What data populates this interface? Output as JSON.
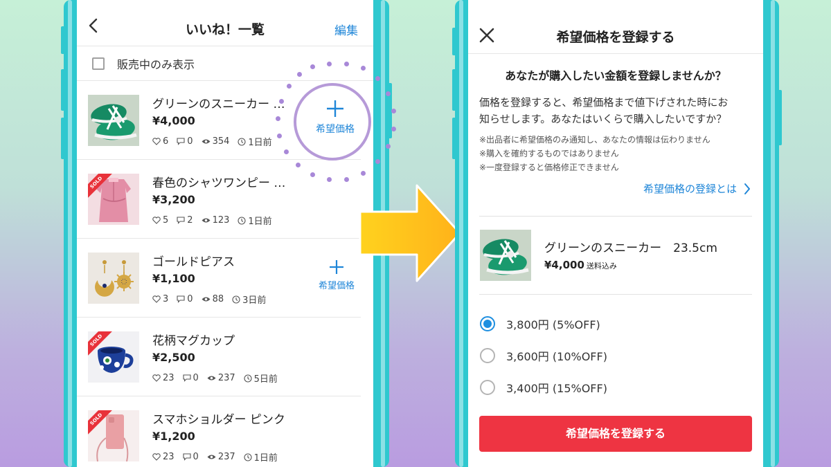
{
  "colors": {
    "accent_blue": "#1f86d8",
    "submit_red": "#ee3442",
    "phone_frame": "#2fc8cf",
    "ring_purple": "#b69ad8",
    "arrow_yellow": "#ffc21a"
  },
  "left": {
    "header": {
      "title": "いいね！一覧",
      "edit_label": "編集"
    },
    "filter": {
      "label": "販売中のみ表示",
      "checked": false
    },
    "items": [
      {
        "name": "グリーンのスニーカー …",
        "price": "¥4,000",
        "likes": "6",
        "comments": "0",
        "views": "354",
        "time": "1日前",
        "sold": false,
        "image": "green-sneakers"
      },
      {
        "name": "春色のシャツワンピー …",
        "price": "¥3,200",
        "likes": "5",
        "comments": "2",
        "views": "123",
        "time": "1日前",
        "sold": true,
        "image": "pink-dress"
      },
      {
        "name": "ゴールドピアス",
        "price": "¥1,100",
        "likes": "3",
        "comments": "0",
        "views": "88",
        "time": "3日前",
        "sold": false,
        "image": "gold-earrings"
      },
      {
        "name": "花柄マグカップ",
        "price": "¥2,500",
        "likes": "23",
        "comments": "0",
        "views": "237",
        "time": "5日前",
        "sold": true,
        "image": "floral-mug"
      },
      {
        "name": "スマホショルダー ピンク",
        "price": "¥1,200",
        "likes": "23",
        "comments": "0",
        "views": "237",
        "time": "1日前",
        "sold": true,
        "image": "pink-phone-case"
      }
    ],
    "sold_label": "SOLD",
    "wish_button_label": "希望価格"
  },
  "right": {
    "header": {
      "title": "希望価格を登録する"
    },
    "lead": "あなたが購入したい金額を登録しませんか？",
    "desc_line1": "価格を登録すると、希望価格まで値下げされた時にお",
    "desc_line2": "知らせします。あなたはいくらで購入したいですか？",
    "notes": [
      "※出品者に希望価格のみ通知し、あなたの情報は伝わりません",
      "※購入を確約するものではありません",
      "※一度登録すると価格修正できません"
    ],
    "about_link": "希望価格の登録とは",
    "product": {
      "name": "グリーンのスニーカー　23.5cm",
      "price": "¥4,000",
      "shipping": "送料込み"
    },
    "options": [
      {
        "label": "3,800円 (5%OFF)",
        "selected": true
      },
      {
        "label": "3,600円 (10%OFF)",
        "selected": false
      },
      {
        "label": "3,400円 (15%OFF)",
        "selected": false
      }
    ],
    "submit_label": "希望価格を登録する"
  }
}
